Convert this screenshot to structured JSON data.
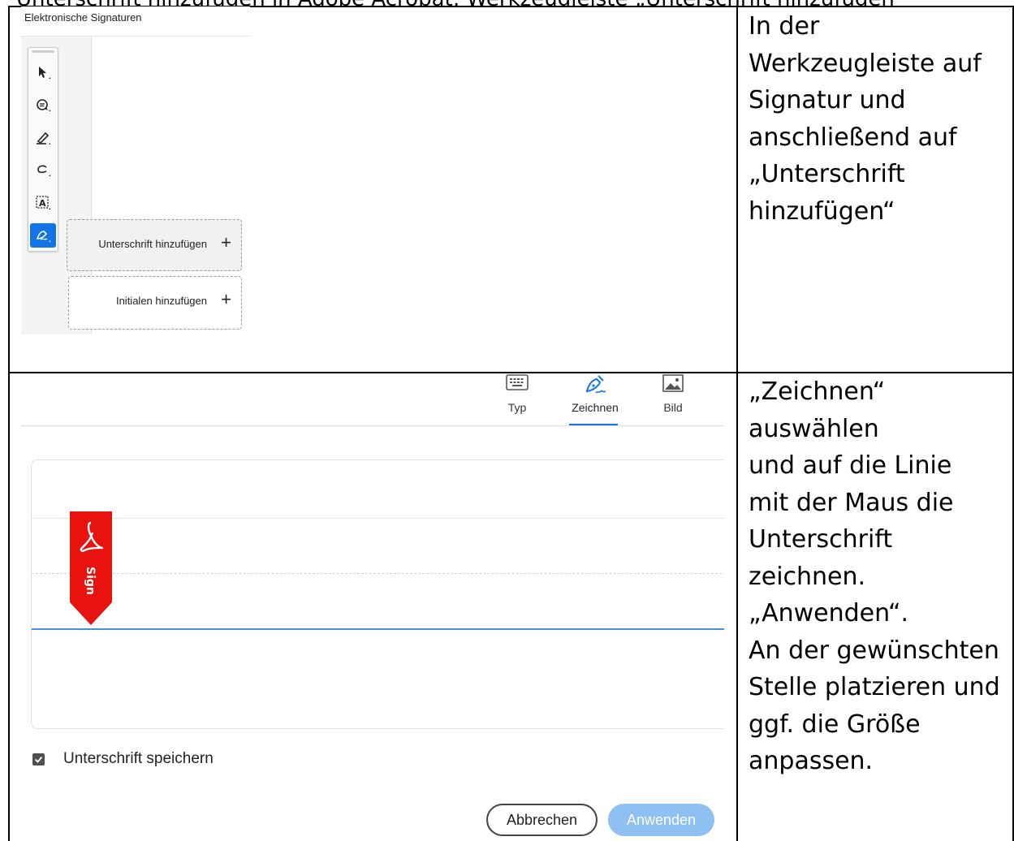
{
  "header": {
    "clipped_text": "Unterschrift hinzufügen in Adobe Acrobat: Werkzeugleiste „Unterschrift hinzufügen“"
  },
  "step1": {
    "screenshot": {
      "panel_title": "Elektronische Signaturen",
      "tools": [
        {
          "icon": "cursor-icon"
        },
        {
          "icon": "comment-icon"
        },
        {
          "icon": "highlighter-icon"
        },
        {
          "icon": "freehand-icon"
        },
        {
          "icon": "text-recognition-icon"
        },
        {
          "icon": "signature-icon",
          "active": true
        }
      ],
      "flyout": {
        "add_signature": "Unterschrift hinzufügen",
        "add_initials": "Initialen hinzufügen",
        "plus": "+"
      }
    },
    "instruction": "In der\nWerkzeugleiste auf\nSignatur und\nanschließend auf\n„Unterschrift\nhinzufügen“"
  },
  "step2": {
    "screenshot": {
      "tabs": [
        {
          "label": "Typ",
          "icon": "keyboard-icon"
        },
        {
          "label": "Zeichnen",
          "icon": "draw-pen-icon",
          "active": true
        },
        {
          "label": "Bild",
          "icon": "image-icon"
        }
      ],
      "sign_tag": "Sign",
      "save_checkbox_label": "Unterschrift speichern",
      "save_checked": true,
      "cancel_label": "Abbrechen",
      "apply_label": "Anwenden"
    },
    "instruction": "„Zeichnen“\nauswählen\nund auf die Linie\nmit der Maus die\nUnterschrift\nzeichnen.\n„Anwenden“.\nAn der gewünschten\nStelle platzieren und\nggf. die Größe\nanpassen."
  },
  "colors": {
    "accent_blue": "#1473e6",
    "apply_disabled": "#8ec0f2",
    "acrobat_red": "#e8130f",
    "signature_line": "#4a90d9"
  }
}
